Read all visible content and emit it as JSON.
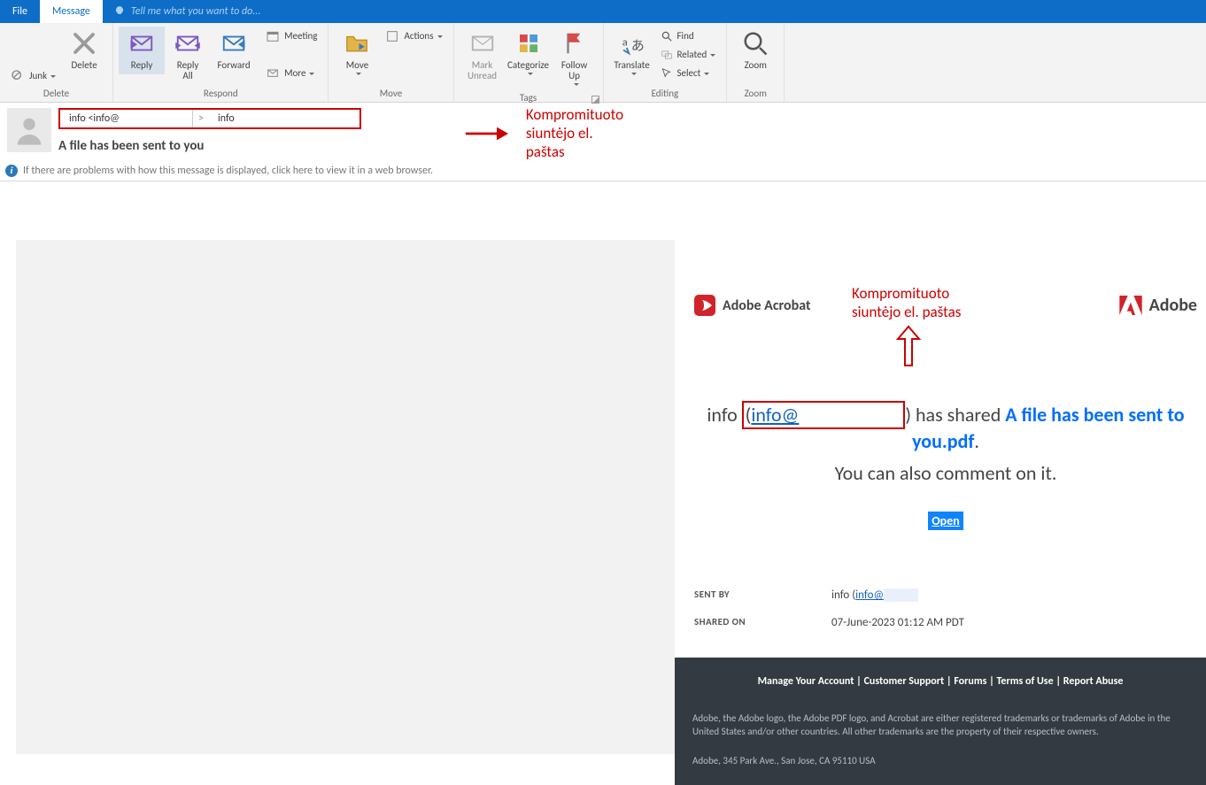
{
  "tabs": {
    "file": "File",
    "message": "Message",
    "tellme": "Tell me what you want to do..."
  },
  "ribbon": {
    "junk": "Junk",
    "delete": "Delete",
    "reply": "Reply",
    "replyall": "Reply\nAll",
    "forward": "Forward",
    "meeting": "Meeting",
    "more": "More",
    "move": "Move",
    "actions": "Actions",
    "mark_unread": "Mark\nUnread",
    "categorize": "Categorize",
    "followup": "Follow\nUp",
    "translate": "Translate",
    "find": "Find",
    "related": "Related",
    "select": "Select",
    "zoom": "Zoom",
    "grp_delete": "Delete",
    "grp_respond": "Respond",
    "grp_move": "Move",
    "grp_tags": "Tags",
    "grp_editing": "Editing",
    "grp_zoom": "Zoom"
  },
  "header": {
    "from1": "info <info@",
    "from_arrow": ">",
    "from2": "info",
    "subject": "A file has been sent to you",
    "info_banner": "If there are problems with how this message is displayed, click here to view it in a web browser."
  },
  "annotation": {
    "line1": "Kompromituoto",
    "line2": "siuntėjo el. paštas"
  },
  "adobe": {
    "acrobat": "Adobe Acrobat",
    "adobe": "Adobe"
  },
  "shared": {
    "pre": "info ",
    "email": "info@",
    "post": ") has shared ",
    "filename": "A file has been sent to you.pdf",
    "dot": ".",
    "comment": "You can also comment on it.",
    "open": "Open",
    "paren": "("
  },
  "meta": {
    "k_sentby": "SENT BY",
    "v_sentby": "info (",
    "v_sentby_email": "info@",
    "k_sharedon": "SHARED ON",
    "v_sharedon": "07-June-2023 01:12 AM PDT"
  },
  "footer": {
    "manage": "Manage Your Account",
    "sep": " | ",
    "support": "Customer Support",
    "forums": "Forums",
    "terms": "Terms of Use",
    "abuse": "Report Abuse",
    "legal": "Adobe, the Adobe logo, the Adobe PDF logo, and Acrobat are either registered trademarks or trademarks of Adobe in the United States and/or other countries. All other trademarks are the property of their respective owners.",
    "addr": "Adobe, 345 Park Ave., San Jose, CA 95110 USA"
  }
}
